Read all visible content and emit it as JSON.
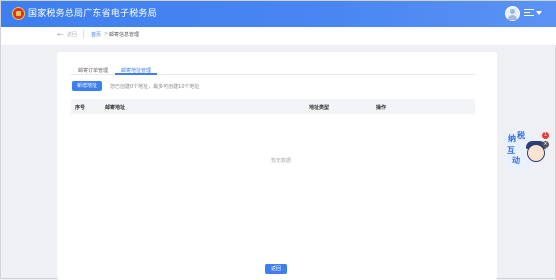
{
  "header": {
    "site_title": "国家税务总局广东省电子税务局"
  },
  "breadcrumb": {
    "back": "返回",
    "home": "首页",
    "separator": ">",
    "current": "邮寄信息管理"
  },
  "tabs": [
    {
      "label": "邮寄订单管理"
    },
    {
      "label": "邮寄地址管理"
    }
  ],
  "toolbar": {
    "add_label": "新增地址",
    "hint": "您已创建0个地址，最多可创建10个地址"
  },
  "table": {
    "columns": [
      "序号",
      "邮寄地址",
      "地址类型",
      "操作"
    ],
    "empty_text": "暂无数据"
  },
  "footer": {
    "return_label": "返回"
  },
  "widget": {
    "chars": [
      "纳",
      "税",
      "互",
      "动"
    ],
    "badge": "1",
    "close": "×"
  },
  "colors": {
    "primary": "#3d7ef0",
    "background": "#eef0f4"
  }
}
